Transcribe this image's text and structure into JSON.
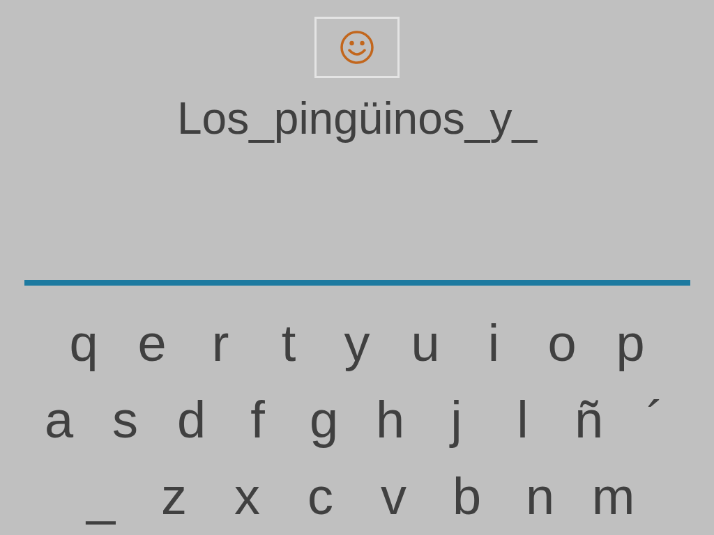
{
  "typed_text": "Los_pingüinos_y_",
  "keyboard": {
    "rows": [
      [
        "q",
        "e",
        "r",
        "t",
        "y",
        "u",
        "i",
        "o",
        "p"
      ],
      [
        "a",
        "s",
        "d",
        "f",
        "g",
        "h",
        "j",
        "l",
        "ñ",
        "´"
      ],
      [
        "_",
        "z",
        "x",
        "c",
        "v",
        "b",
        "n",
        "m"
      ]
    ]
  }
}
